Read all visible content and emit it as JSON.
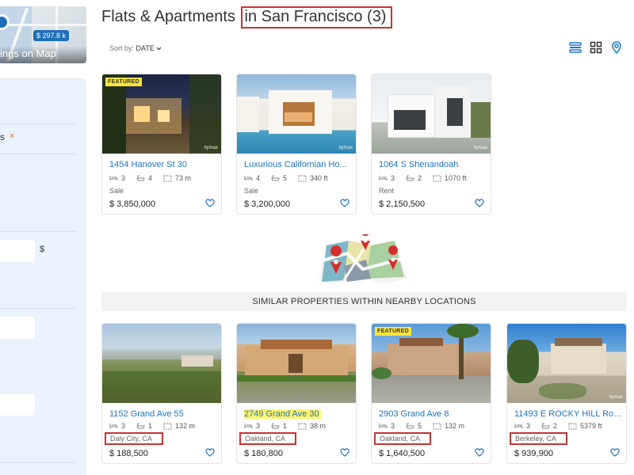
{
  "sidebar": {
    "map_button_label": "ings on Map",
    "map_price_pin": "$ 297.8 k",
    "filter_tag_text": "s",
    "filter_tag_remove": "×",
    "currency_symbol": "$"
  },
  "header": {
    "title_prefix": "Flats & Apartments ",
    "title_highlight": "in San Francisco (3)",
    "sort_label": "Sort by:",
    "sort_value": "DATE"
  },
  "listings": [
    {
      "name": "1454 Hanover St 30",
      "beds": "3",
      "baths": "4",
      "area": "73 m",
      "status": "Sale",
      "price": "$ 3,850,000",
      "featured": "FEATURED",
      "watermark": "flymax"
    },
    {
      "name": "Luxurious Californian Ho...",
      "beds": "4",
      "baths": "5",
      "area": "340 ft",
      "status": "Sale",
      "price": "$ 3,200,000",
      "watermark": "flymax"
    },
    {
      "name": "1064 S Shenandoah",
      "beds": "3",
      "baths": "2",
      "area": "1070 ft",
      "status": "Rent",
      "price": "$ 2,150,500",
      "watermark": "flymax"
    }
  ],
  "similar_heading": "SIMILAR PROPERTIES WITHIN NEARBY LOCATIONS",
  "nearby": [
    {
      "name": "1152 Grand Ave 55",
      "beds": "3",
      "baths": "1",
      "area": "132 m",
      "location": "Daly City, CA",
      "price": "$ 188,500"
    },
    {
      "name": "2749 Grand Ave 30",
      "beds": "3",
      "baths": "1",
      "area": "38 m",
      "location": "Oakland, CA",
      "price": "$ 180,800"
    },
    {
      "name": "2903 Grand Ave 8",
      "beds": "3",
      "baths": "5",
      "area": "132 m",
      "location": "Oakland, CA",
      "price": "$ 1,640,500",
      "featured": "FEATURED"
    },
    {
      "name": "11493 E ROCKY HILL Roa...",
      "beds": "3",
      "baths": "2",
      "area": "5379 ft",
      "location": "Berkeley, CA",
      "price": "$ 939,900",
      "watermark": "flymax"
    }
  ],
  "colors": {
    "accent": "#1f73c4",
    "highlight_box": "#c9332f",
    "featured": "#ffe53a"
  }
}
